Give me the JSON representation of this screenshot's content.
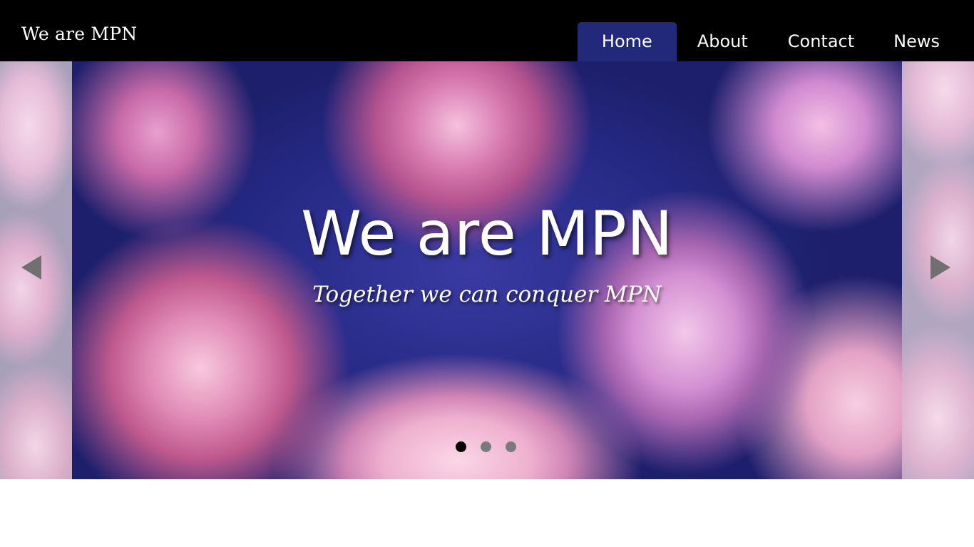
{
  "header": {
    "brand": "We are MPN",
    "nav": [
      {
        "label": "Home",
        "active": true
      },
      {
        "label": "About",
        "active": false
      },
      {
        "label": "Contact",
        "active": false
      },
      {
        "label": "News",
        "active": false
      }
    ]
  },
  "hero": {
    "title": "We are MPN",
    "subtitle": "Together we can conquer MPN",
    "prev_icon": "triangle-left-arrow-icon",
    "next_icon": "triangle-right-arrow-icon",
    "slides_count": 3,
    "active_slide": 1
  },
  "colors": {
    "header_bg": "#000000",
    "nav_active_bg": "#22287a",
    "text": "#ffffff",
    "arrow": "#707070",
    "dot_active": "#000000",
    "dot_inactive": "#7a7a7a"
  }
}
